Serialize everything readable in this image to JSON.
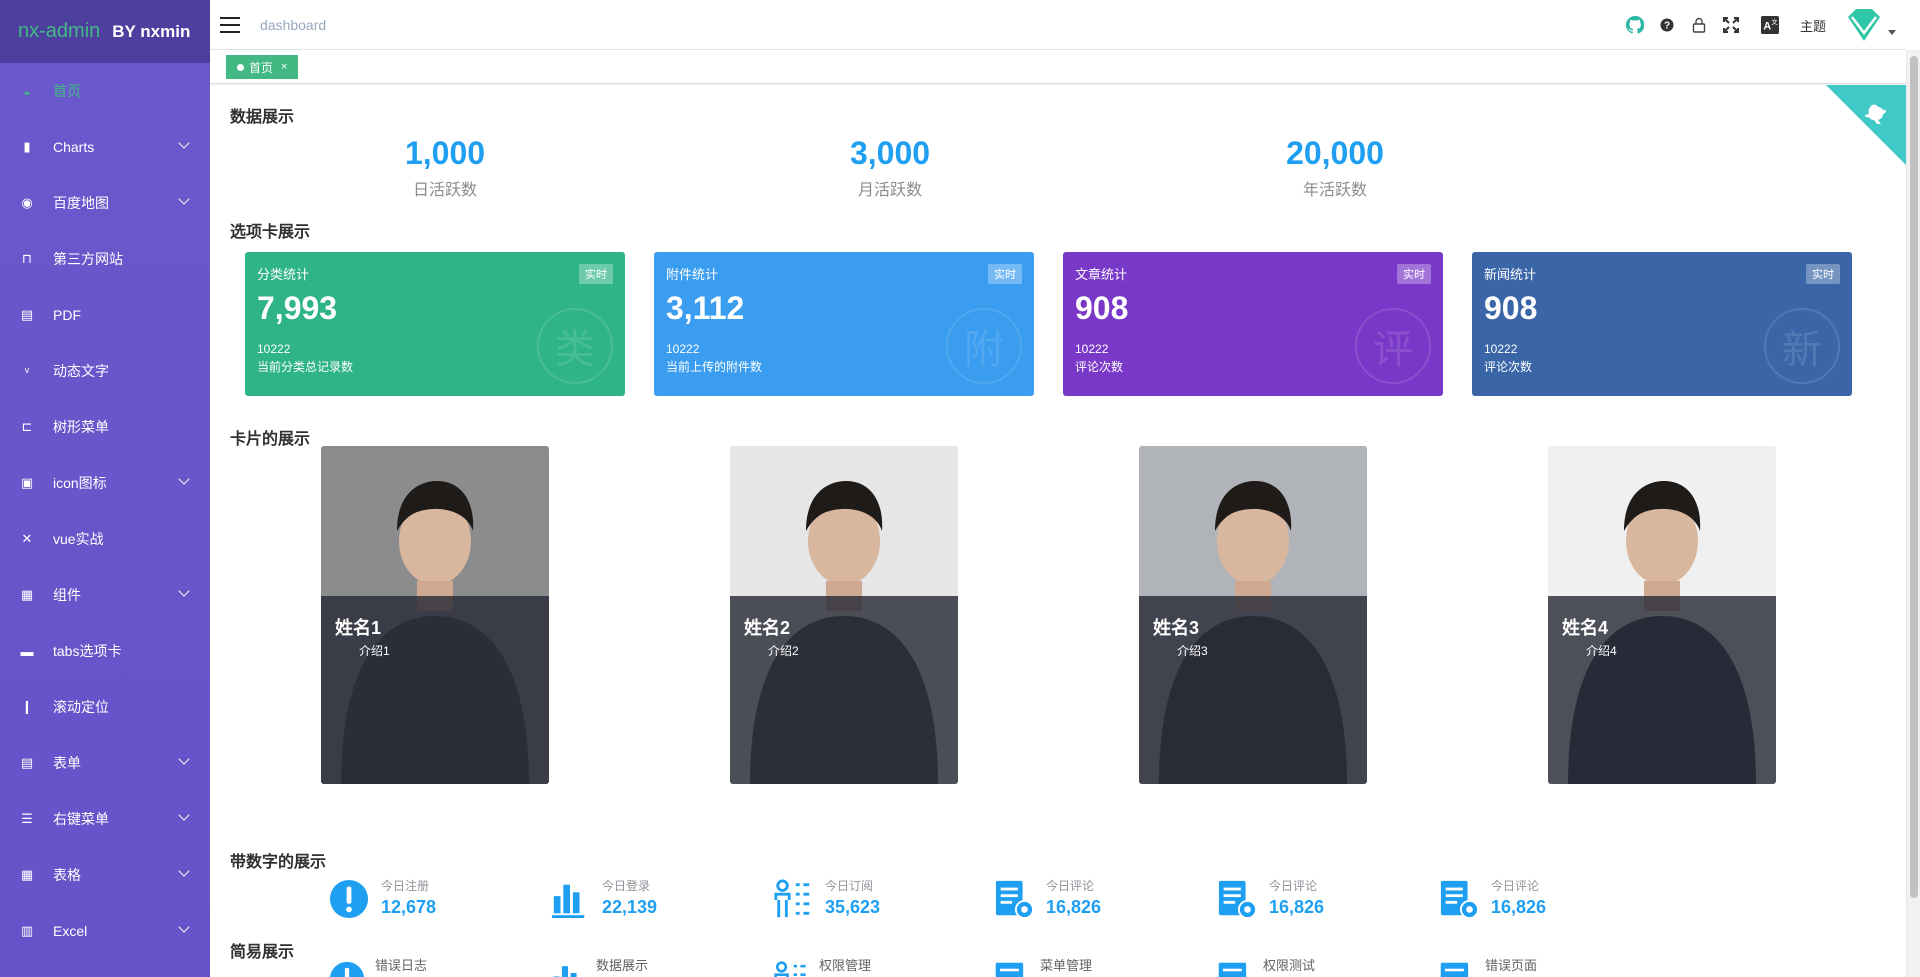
{
  "app": {
    "logo_main": "nx-admin",
    "logo_by": "BY nxmin"
  },
  "menu": [
    {
      "label": "首页",
      "icon": "dashboard-icon",
      "active": true,
      "has_children": false
    },
    {
      "label": "Charts",
      "icon": "chart-icon",
      "active": false,
      "has_children": true
    },
    {
      "label": "百度地图",
      "icon": "map-icon",
      "active": false,
      "has_children": true
    },
    {
      "label": "第三方网站",
      "icon": "bus-icon",
      "active": false,
      "has_children": false
    },
    {
      "label": "PDF",
      "icon": "pdf-icon",
      "active": false,
      "has_children": false
    },
    {
      "label": "动态文字",
      "icon": "text-icon",
      "active": false,
      "has_children": false
    },
    {
      "label": "树形菜单",
      "icon": "tree-icon",
      "active": false,
      "has_children": false
    },
    {
      "label": "icon图标",
      "icon": "icon-icon",
      "active": false,
      "has_children": true
    },
    {
      "label": "vue实战",
      "icon": "close-cross-icon",
      "active": false,
      "has_children": false
    },
    {
      "label": "组件",
      "icon": "component-icon",
      "active": false,
      "has_children": true
    },
    {
      "label": "tabs选项卡",
      "icon": "tab-icon",
      "active": false,
      "has_children": false
    },
    {
      "label": "滚动定位",
      "icon": "scroll-icon",
      "active": false,
      "has_children": false
    },
    {
      "label": "表单",
      "icon": "form-icon",
      "active": false,
      "has_children": true
    },
    {
      "label": "右键菜单",
      "icon": "list-icon",
      "active": false,
      "has_children": true
    },
    {
      "label": "表格",
      "icon": "table-icon",
      "active": false,
      "has_children": true
    },
    {
      "label": "Excel",
      "icon": "excel-icon",
      "active": false,
      "has_children": true
    }
  ],
  "header": {
    "breadcrumb": "dashboard",
    "theme_label": "主题"
  },
  "tags": {
    "home_label": "首页",
    "close_glyph": "×"
  },
  "sections": {
    "data": "数据展示",
    "tabs": "选项卡展示",
    "cards": "卡片的展示",
    "numbers": "带数字的展示",
    "simple": "简易展示"
  },
  "stats": [
    {
      "value": "1,000",
      "label": "日活跃数"
    },
    {
      "value": "3,000",
      "label": "月活跃数"
    },
    {
      "value": "20,000",
      "label": "年活跃数"
    }
  ],
  "cards": [
    {
      "title": "分类统计",
      "badge": "实时",
      "value": "7,993",
      "sub": "10222",
      "desc": "当前分类总记录数",
      "wm": "类",
      "color": "#2fb48a"
    },
    {
      "title": "附件统计",
      "badge": "实时",
      "value": "3,112",
      "sub": "10222",
      "desc": "当前上传的附件数",
      "wm": "附",
      "color": "#3a9df0"
    },
    {
      "title": "文章统计",
      "badge": "实时",
      "value": "908",
      "sub": "10222",
      "desc": "评论次数",
      "wm": "评",
      "color": "#7a38c8"
    },
    {
      "title": "新闻统计",
      "badge": "实时",
      "value": "908",
      "sub": "10222",
      "desc": "评论次数",
      "wm": "新",
      "color": "#3a66a8"
    }
  ],
  "people": [
    {
      "name": "姓名1",
      "desc": "介绍1"
    },
    {
      "name": "姓名2",
      "desc": "介绍2"
    },
    {
      "name": "姓名3",
      "desc": "介绍3"
    },
    {
      "name": "姓名4",
      "desc": "介绍4"
    }
  ],
  "numbers": [
    {
      "label": "今日注册",
      "value": "12,678",
      "icon": "exclamation-circle-icon"
    },
    {
      "label": "今日登录",
      "value": "22,139",
      "icon": "bar-chart-icon"
    },
    {
      "label": "今日订阅",
      "value": "35,623",
      "icon": "person-list-icon"
    },
    {
      "label": "今日评论",
      "value": "16,826",
      "icon": "doc-gear-icon"
    },
    {
      "label": "今日评论",
      "value": "16,826",
      "icon": "doc-gear-icon"
    },
    {
      "label": "今日评论",
      "value": "16,826",
      "icon": "doc-gear-icon"
    }
  ],
  "simple": [
    {
      "label": "错误日志",
      "icon": "exclamation-circle-icon"
    },
    {
      "label": "数据展示",
      "icon": "bar-chart-icon"
    },
    {
      "label": "权限管理",
      "icon": "person-list-icon"
    },
    {
      "label": "菜单管理",
      "icon": "doc-icon"
    },
    {
      "label": "权限测试",
      "icon": "doc-icon"
    },
    {
      "label": "错误页面",
      "icon": "doc-icon"
    }
  ],
  "colors": {
    "sidebar": "#6a58cc",
    "accent": "#42b983",
    "number_blue": "#1e9ff2"
  }
}
